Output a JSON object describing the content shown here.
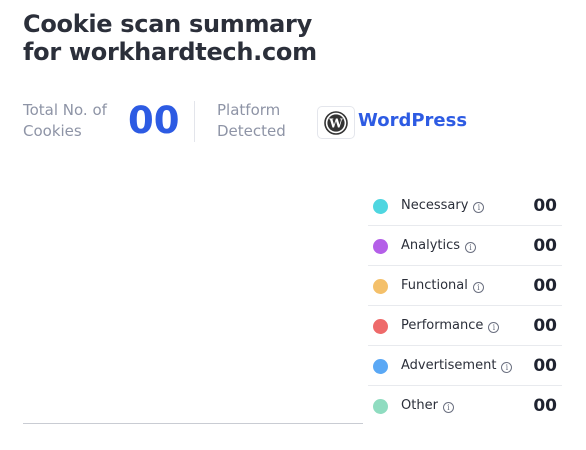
{
  "header": {
    "title_line1": "Cookie scan summary",
    "title_line2": "for workhardtech.com"
  },
  "stats": {
    "total_label": "Total No. of Cookies",
    "total_count": "00",
    "platform_label": "Platform Detected",
    "platform_icon": "wordpress-logo",
    "platform_name": "WordPress"
  },
  "legend": [
    {
      "label": "Necessary",
      "count": "00",
      "color": "#4fd6e0",
      "icon": "info-icon"
    },
    {
      "label": "Analytics",
      "count": "00",
      "color": "#b45fe8",
      "icon": "info-icon"
    },
    {
      "label": "Functional",
      "count": "00",
      "color": "#f4c06a",
      "icon": "info-icon"
    },
    {
      "label": "Performance",
      "count": "00",
      "color": "#ee6a6a",
      "icon": "info-icon"
    },
    {
      "label": "Advertisement",
      "count": "00",
      "color": "#5aa8f5",
      "icon": "info-icon"
    },
    {
      "label": "Other",
      "count": "00",
      "color": "#8fdcc0",
      "icon": "info-icon"
    }
  ]
}
